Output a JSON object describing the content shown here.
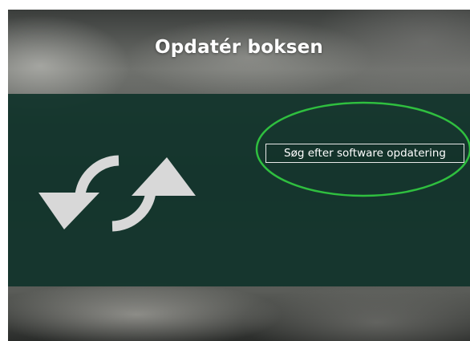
{
  "screen": {
    "title": "Opdatér boksen"
  },
  "menu": {
    "update_button_label": "Søg efter software opdatering"
  },
  "icons": {
    "main": "refresh-icon"
  },
  "colors": {
    "panel": "#11342b",
    "highlight": "#2fbf3f",
    "icon": "#d8d8d8",
    "text": "#ffffff"
  }
}
